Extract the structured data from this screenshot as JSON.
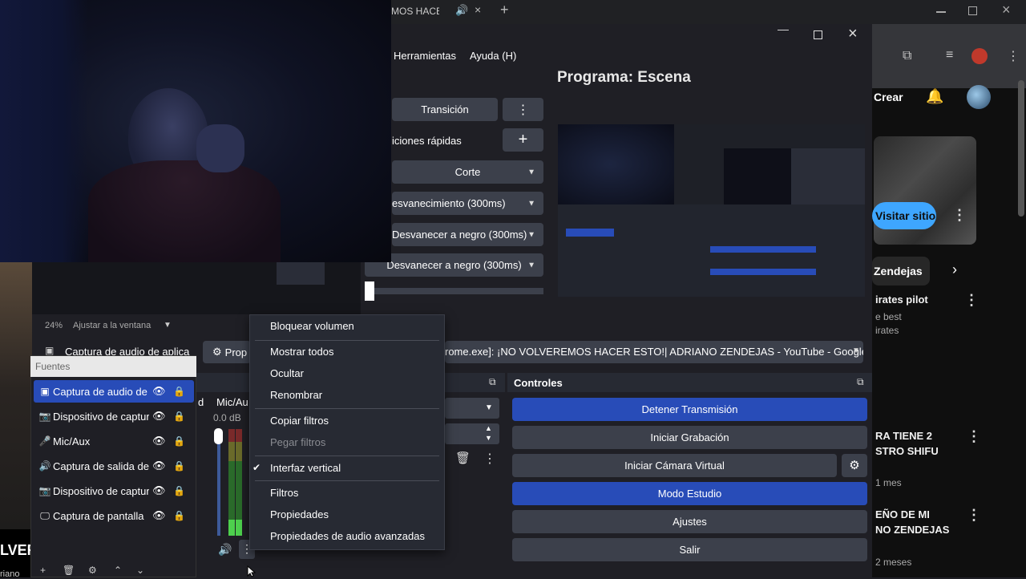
{
  "browser": {
    "tab_title": "MOS HACER",
    "create_label": "Crear",
    "visit_site_label": "Visitar sitio",
    "channel_label": "Zendejas",
    "video1_title": "irates pilot",
    "video1_sub1": "e best",
    "video1_sub2": "irates",
    "video2_title1": "RA TIENE 2",
    "video2_title2": "STRO SHIFU",
    "video2_time": "1 mes",
    "video3_title1": "EÑO DE MI",
    "video3_title2": "NO ZENDEJAS",
    "video3_time": "2 meses",
    "left_partial_1": "LVER",
    "left_partial_2": "riano"
  },
  "obs": {
    "menu": [
      "Herramientas",
      "Ayuda (H)"
    ],
    "program_title": "Programa: Escena",
    "transition_label": "Transición",
    "quick_transitions_label": "iciones rápidas",
    "transitions": [
      "Corte",
      "esvanecimiento (300ms)",
      "Desvanecer a negro (300ms)",
      "Desvanecer a negro (300ms)"
    ],
    "zoom": "24%",
    "fit_label": "Ajustar a la ventana",
    "source_bar_label": "Captura de audio de aplica",
    "props_label": "Prop",
    "window_title": "rome.exe]: ¡NO VOLVEREMOS HACER ESTO!| ADRIANO ZENDEJAS - YouTube - Google (",
    "mixer": {
      "label": "Mic/Aux",
      "db": "0.0 dB",
      "partial": "d"
    },
    "controls_title": "Controles",
    "controls": [
      {
        "label": "Detener Transmisión",
        "active": true
      },
      {
        "label": "Iniciar Grabación",
        "active": false
      },
      {
        "label": "Iniciar Cámara Virtual",
        "active": false
      },
      {
        "label": "Modo Estudio",
        "active": true
      },
      {
        "label": "Ajustes",
        "active": false
      },
      {
        "label": "Salir",
        "active": false
      }
    ],
    "sources_title": "Fuentes",
    "sources": [
      {
        "label": "Captura de audio de",
        "icon": "app-audio-icon",
        "selected": true
      },
      {
        "label": "Dispositivo de captur",
        "icon": "camera-icon",
        "selected": false
      },
      {
        "label": "Mic/Aux",
        "icon": "mic-icon",
        "selected": false
      },
      {
        "label": "Captura de salida de",
        "icon": "speaker-icon",
        "selected": false
      },
      {
        "label": "Dispositivo de captur",
        "icon": "camera-icon",
        "selected": false
      },
      {
        "label": "Captura de pantalla",
        "icon": "monitor-icon",
        "selected": false
      }
    ]
  },
  "context_menu": {
    "items": [
      {
        "label": "Bloquear volumen",
        "disabled": false,
        "checked": false
      },
      {
        "label": "Mostrar todos",
        "disabled": false,
        "checked": false
      },
      {
        "label": "Ocultar",
        "disabled": false,
        "checked": false
      },
      {
        "label": "Renombrar",
        "disabled": false,
        "checked": false
      },
      {
        "label": "Copiar filtros",
        "disabled": false,
        "checked": false
      },
      {
        "label": "Pegar filtros",
        "disabled": true,
        "checked": false
      },
      {
        "label": "Interfaz vertical",
        "disabled": false,
        "checked": true
      },
      {
        "label": "Filtros",
        "disabled": false,
        "checked": false
      },
      {
        "label": "Propiedades",
        "disabled": false,
        "checked": false
      },
      {
        "label": "Propiedades de audio avanzadas",
        "disabled": false,
        "checked": false
      }
    ]
  },
  "colors": {
    "accent": "#284cb8",
    "button": "#3c404b",
    "bg": "#1f1f25"
  }
}
